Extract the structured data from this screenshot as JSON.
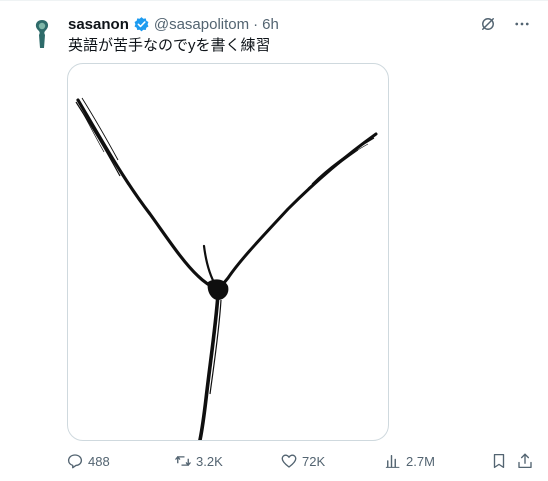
{
  "tweet": {
    "author": {
      "display_name": "sasanon",
      "handle": "@sasapolitom",
      "verified": true
    },
    "separator": "·",
    "time": "6h",
    "text": "英語が苦手なのでyを書く練習",
    "media_description": "a hand-drawn black ink letter y shaped like a branching stroke",
    "colors": {
      "accent": "#1d9bf0",
      "secondary_text": "#536471",
      "primary_text": "#0f1419",
      "avatar": "#2e6b6a"
    },
    "icons": {
      "grok": "grok-icon",
      "more": "more-icon",
      "reply": "reply-icon",
      "retweet": "retweet-icon",
      "like": "like-icon",
      "views": "views-icon",
      "bookmark": "bookmark-icon",
      "share": "share-icon"
    },
    "metrics": {
      "replies": "488",
      "retweets": "3.2K",
      "likes": "72K",
      "views": "2.7M"
    }
  }
}
